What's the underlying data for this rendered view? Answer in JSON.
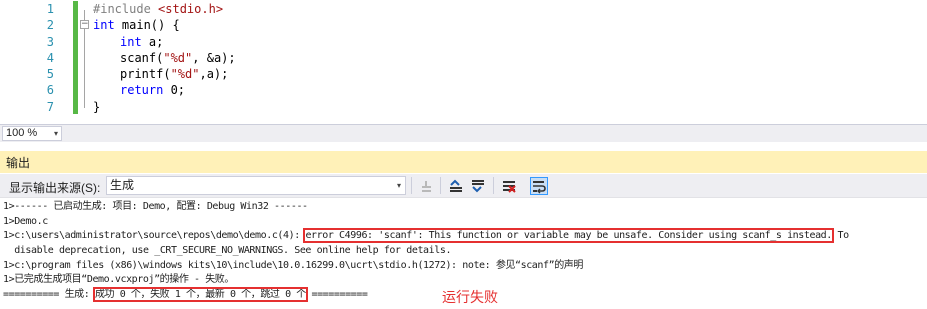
{
  "editor": {
    "line_numbers": [
      "1",
      "2",
      "3",
      "4",
      "5",
      "6",
      "7"
    ],
    "code": {
      "l1_directive": "#include",
      "l1_header": " <stdio.h>",
      "l2_kw": "int",
      "l2_rest": " main() {",
      "l3_kw": "int",
      "l3_rest": " a;",
      "l4_pre": "scanf(",
      "l4_str": "\"%d\"",
      "l4_post": ", &a);",
      "l5_pre": "printf(",
      "l5_str": "\"%d\"",
      "l5_post": ",a);",
      "l6_kw": "return",
      "l6_rest": " 0;",
      "l7": "}"
    },
    "outline_collapse_glyph": "−",
    "change_bar_color": "#57b846"
  },
  "zoom": {
    "value": "100 %",
    "arrow": "▾"
  },
  "output": {
    "title": "输出",
    "source_label": "显示输出来源(S):",
    "source_value": "生成",
    "source_arrow": "▾",
    "header_color": "#fff1b8",
    "lines": {
      "l1": "1>------ 已启动生成: 项目: Demo, 配置: Debug Win32 ------",
      "l2": "1>Demo.c",
      "l3_path": "1>c:\\users\\administrator\\source\\repos\\demo\\demo.c(4): ",
      "l3_error": "error C4996: 'scanf': This function or variable may be unsafe. Consider using scanf_s instead.",
      "l3_tail": " To",
      "l4": "  disable deprecation, use _CRT_SECURE_NO_WARNINGS. See online help for details.",
      "l5": "1>c:\\program files (x86)\\windows kits\\10\\include\\10.0.16299.0\\ucrt\\stdio.h(1272): note: 参见“scanf”的声明",
      "l6": "1>已完成生成项目“Demo.vcxproj”的操作 - 失败。",
      "l7_pre": "========== 生成: ",
      "l7_summary": "成功 0 个，失败 1 个，最新 0 个，跳过 0 个",
      "l7_post": " =========="
    },
    "annotation": "运行失败",
    "highlight_color": "#e53030"
  },
  "toolbar_icons": [
    "goto-previous-message-icon",
    "find-previous-message-icon",
    "find-next-message-icon",
    "clear-all-icon",
    "toggle-word-wrap-icon"
  ]
}
